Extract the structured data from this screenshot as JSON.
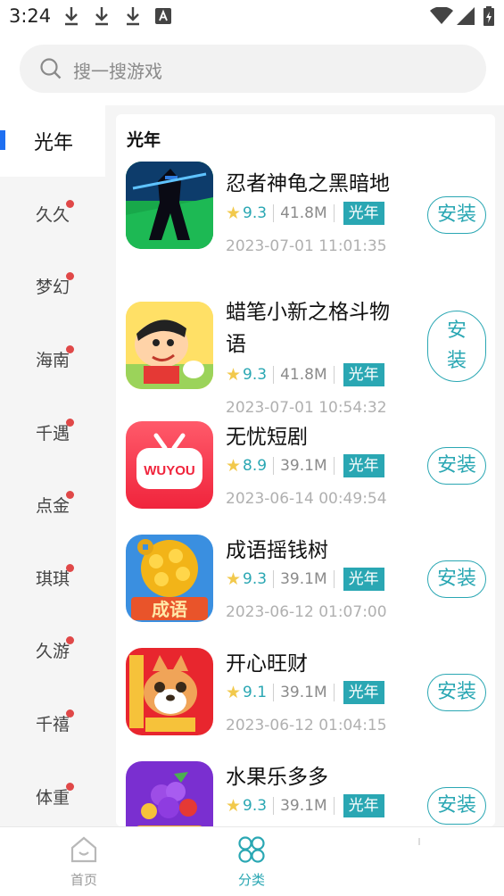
{
  "status_bar": {
    "time": "3:24"
  },
  "search": {
    "placeholder": "搜一搜游戏"
  },
  "sidebar": {
    "items": [
      {
        "label": "光年",
        "active": true
      },
      {
        "label": "久久"
      },
      {
        "label": "梦幻"
      },
      {
        "label": "海南"
      },
      {
        "label": "千遇"
      },
      {
        "label": "点金"
      },
      {
        "label": "琪琪"
      },
      {
        "label": "久游"
      },
      {
        "label": "千禧"
      },
      {
        "label": "体重"
      }
    ]
  },
  "main": {
    "section_title": "光年",
    "apps": [
      {
        "name": "忍者神龟之黑暗地",
        "rating": "9.3",
        "size": "41.8M",
        "tag": "光年",
        "date": "2023-07-01 11:01:35",
        "button": "安装"
      },
      {
        "name": "蜡笔小新之格斗物语",
        "name_line1": "蜡笔小新之格斗物",
        "name_line2": "语",
        "rating": "9.3",
        "size": "41.8M",
        "tag": "光年",
        "date": "2023-07-01 10:54:32",
        "button": "安装",
        "button_line1": "安",
        "button_line2": "装"
      },
      {
        "name": "无忧短剧",
        "rating": "8.9",
        "size": "39.1M",
        "tag": "光年",
        "date": "2023-06-14 00:49:54",
        "button": "安装",
        "icon_text": "WUYOU"
      },
      {
        "name": "成语摇钱树",
        "rating": "9.3",
        "size": "39.1M",
        "tag": "光年",
        "date": "2023-06-12 01:07:00",
        "button": "安装",
        "icon_text": "成语"
      },
      {
        "name": "开心旺财",
        "rating": "9.1",
        "size": "39.1M",
        "tag": "光年",
        "date": "2023-06-12 01:04:15",
        "button": "安装"
      },
      {
        "name": "水果乐多多",
        "rating": "9.3",
        "size": "39.1M",
        "tag": "光年",
        "date": "",
        "button": "安装"
      }
    ]
  },
  "bottom_nav": {
    "items": [
      {
        "label": "首页",
        "icon": "home-icon"
      },
      {
        "label": "分类",
        "icon": "category-icon",
        "active": true
      },
      {
        "label": "",
        "icon": "profile-icon"
      }
    ]
  },
  "colors": {
    "accent": "#2aa7b3",
    "active_bar": "#1e6ff1",
    "badge": "#e04848",
    "star": "#f2c94c"
  }
}
